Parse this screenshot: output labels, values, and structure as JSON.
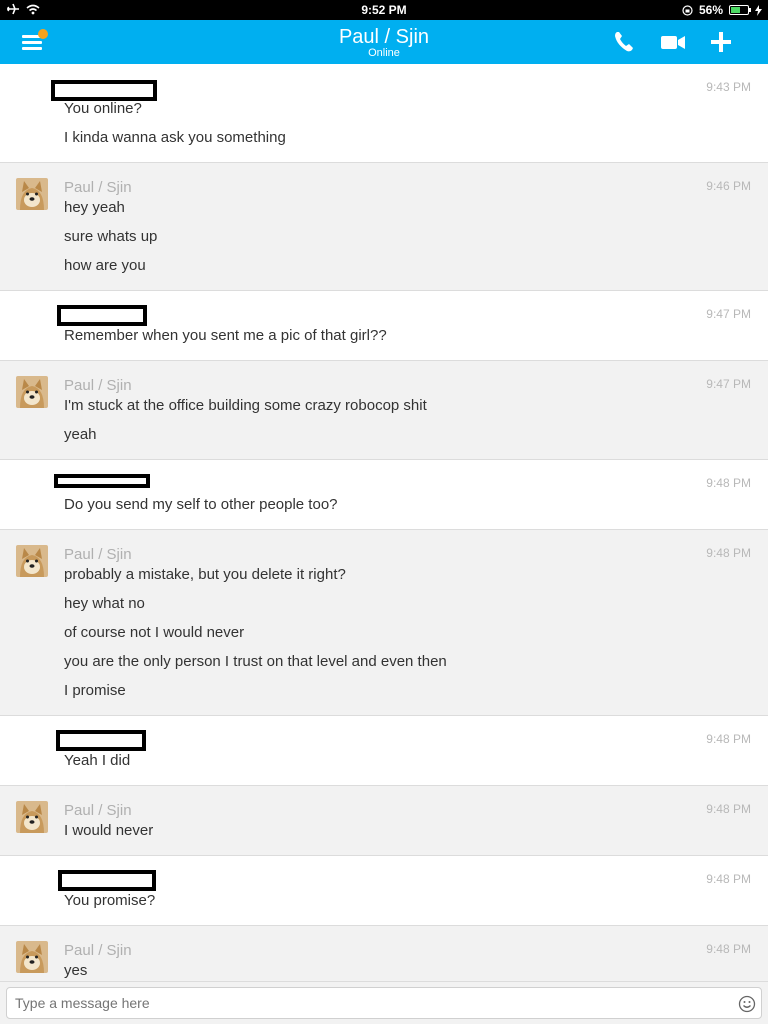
{
  "status_bar": {
    "time": "9:52 PM",
    "battery_text": "56%",
    "battery_level": 0.56
  },
  "header": {
    "title": "Paul / Sjin",
    "subtitle": "Online",
    "accent_color": "#00aff0",
    "notification_dot_color": "#f7a21b"
  },
  "conversation": {
    "contact_name": "Paul / Sjin",
    "groups": [
      {
        "from": "me",
        "time": "9:43 PM",
        "lines": [
          "You online?",
          "I kinda wanna ask you something"
        ]
      },
      {
        "from": "them",
        "time": "9:46 PM",
        "lines": [
          "hey yeah",
          "sure whats up",
          "how are you"
        ]
      },
      {
        "from": "me",
        "time": "9:47 PM",
        "lines": [
          "Remember when you sent me a pic of that girl??"
        ]
      },
      {
        "from": "them",
        "time": "9:47 PM",
        "lines": [
          "I'm stuck at the office building some crazy robocop shit",
          "yeah"
        ]
      },
      {
        "from": "me",
        "time": "9:48 PM",
        "lines": [
          "Do you send my self to other people too?"
        ]
      },
      {
        "from": "them",
        "time": "9:48 PM",
        "lines": [
          "probably a mistake, but you delete it right?",
          "hey what no",
          "of course not I would never",
          "you are the only person I trust on that level and even then",
          "I promise"
        ]
      },
      {
        "from": "me",
        "time": "9:48 PM",
        "lines": [
          "Yeah I did"
        ]
      },
      {
        "from": "them",
        "time": "9:48 PM",
        "lines": [
          "I would never"
        ]
      },
      {
        "from": "me",
        "time": "9:48 PM",
        "lines": [
          "You promise?"
        ]
      },
      {
        "from": "them",
        "time": "9:48 PM",
        "lines": [
          "yes"
        ]
      }
    ]
  },
  "composer": {
    "placeholder": "Type a message here"
  },
  "icons": {
    "menu": "hamburger-menu-icon",
    "call": "phone-icon",
    "video": "video-camera-icon",
    "add": "plus-icon",
    "emoji": "smiley-icon",
    "avatar": "doge-avatar"
  }
}
